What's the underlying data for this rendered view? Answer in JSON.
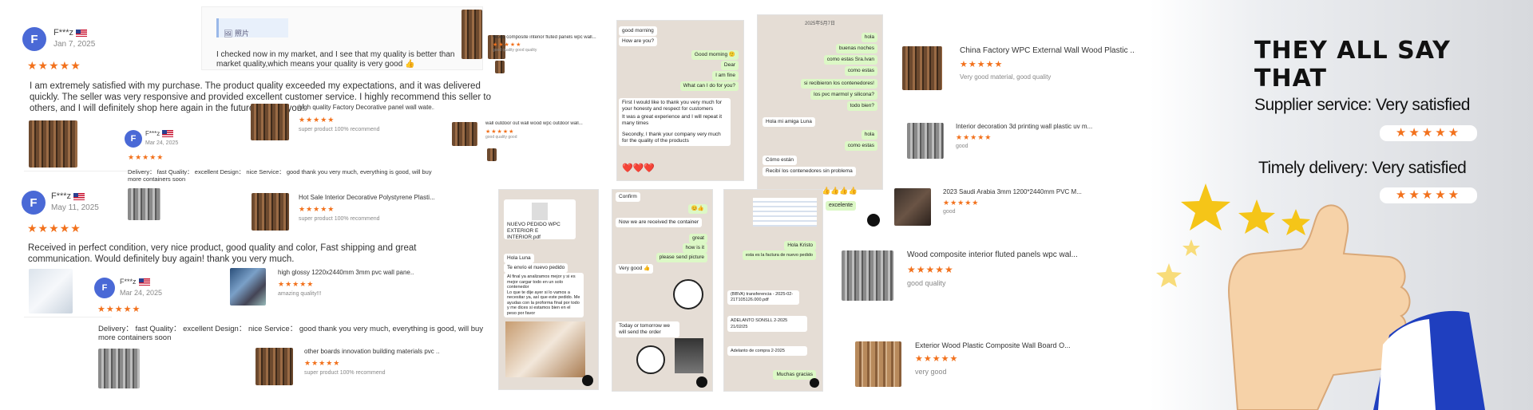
{
  "reviews": [
    {
      "initial": "F",
      "user": "F***z",
      "date": "Jan 7, 2025",
      "stars": "★★★★★",
      "text": "I am extremely satisfied with my purchase. The product quality exceeded my expectations, and it was delivered quickly. The seller was very responsive and provided excellent customer service. I highly recommend this seller to others, and I will definitely shop here again in the future. Thank you!"
    },
    {
      "initial": "F",
      "user": "F***z",
      "date": "May 11, 2025",
      "stars": "★★★★★",
      "text": "Received in perfect condition, very nice product, good quality and color, Fast shipping and great communication. Would definitely buy again! thank you very much."
    },
    {
      "initial": "F",
      "user": "F***z",
      "date": "Mar 24, 2025",
      "stars": "★★★★★",
      "text": "Delivery： fast Quality： excellent Design： nice Service： good thank you very much, everything is good, will buy more containers soon"
    },
    {
      "initial": "F",
      "user": "F***z",
      "date": "Mar 24, 2025",
      "stars": "★★★★★",
      "text": "Delivery： fast Quality： excellent Design： nice Service： good thank you very much, everything is good, will buy more containers soon"
    }
  ],
  "note_card": {
    "label": "照片",
    "text": "I checked now in my market, and I see that my quality is better than market quality,which means your quality is very good 👍"
  },
  "products_small": [
    {
      "title": "Wood composite interior fluted panels wpc wall...",
      "stars": "★★★★★",
      "sub": "good quality good quality"
    },
    {
      "title": "high quality Factory Decorative panel wall wate...",
      "stars": "★★★★★",
      "sub": "super product 100% recommend"
    },
    {
      "title": "wall outdoor out wall wood wpc outdoor wall...",
      "stars": "★★★★★",
      "sub": "good quality good"
    },
    {
      "title": "Hot Sale Interior Decorative Polystyrene Plasti...",
      "stars": "★★★★★",
      "sub": "super product 100% recommend"
    },
    {
      "title": "high glossy 1220x2440mm 3mm pvc wall pane...",
      "stars": "★★★★★",
      "sub": "amazing quality!!!"
    },
    {
      "title": "other boards innovation building materials pvc ...",
      "stars": "★★★★★",
      "sub": "super product 100% recommend"
    }
  ],
  "products_right": [
    {
      "title": "China Factory WPC External Wall Wood Plastic ...",
      "stars": "★★★★★",
      "sub": "Very good material, good quality"
    },
    {
      "title": "Interior decoration 3d printing wall plastic uv m...",
      "stars": "★★★★★",
      "sub": "good"
    },
    {
      "title": "2023 Saudi Arabia 3mm 1200*2440mm PVC M...",
      "stars": "★★★★★",
      "sub": "good"
    },
    {
      "title": "Wood composite interior fluted panels wpc wal...",
      "stars": "★★★★★",
      "sub": "good quality"
    },
    {
      "title": "Exterior Wood Plastic Composite Wall Board O...",
      "stars": "★★★★★",
      "sub": "very good"
    }
  ],
  "chat1": {
    "msgs": [
      "good morning",
      "How are you?",
      "Good morning 🙂",
      "Dear",
      "I am fine",
      "What can I do for you?",
      "First I would like to thank you very much for your honesty and respect for customers",
      "It was a great experience and I will repeat it many times",
      "Secondly, I thank your company very much for the quality of the products",
      "❤️❤️❤️"
    ]
  },
  "chat2": {
    "date": "2025年5月7日",
    "msgs": [
      "hola",
      "buenas noches",
      "como estas Sra.Ivan",
      "como estas",
      "si recibieron los contenedores!",
      "los pvc marmol y silicona?",
      "todo bien?",
      "Hola mi amiga Luna",
      "hola",
      "como estas",
      "Cómo están",
      "Recibí los contenedores sin problema",
      "👍👍👍👍",
      "excelente"
    ]
  },
  "chat3": {
    "msgs": [
      "NUEVO PEDIDO WPC EXTERIOR E INTERIOR.pdf",
      "Hola Luna",
      "Te envío el nuevo pedido",
      "Al final ya analizamos mejor y si es mejor cargar todo en un solo contenedor",
      "Lo que te dije ayer si lo vamos a necesitar ya, así que este pedido. Me ayudas con la proforma final por todo y me dices si estamos bien en el peso por favor"
    ]
  },
  "chat4": {
    "msgs": [
      "Confirm",
      "😊👍",
      "Now we are received the container",
      "great",
      "how is it",
      "please send picture",
      "Very good 👍",
      "Today or tomorrow we will send the order"
    ]
  },
  "chat5": {
    "msgs": [
      "Hola Kristo",
      "esta es la factura de nuevo pedido",
      "(BBVA) transferencia - 2025-02-21T105126.000.pdf",
      "ADELANTO SONSLL 2-2025 21/02/25",
      "Adelanto de compra 2-2025",
      "Muchas gracias"
    ]
  },
  "hero": {
    "headline": "THEY ALL SAY THAT",
    "claim1": "Supplier service: Very satisfied",
    "claim2": "Timely delivery: Very satisfied",
    "stars": "★★★★★"
  }
}
